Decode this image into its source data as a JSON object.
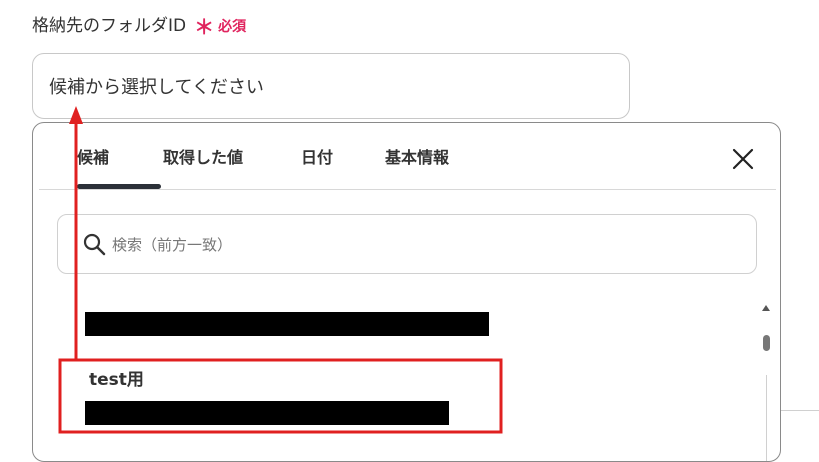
{
  "field": {
    "label": "格納先のフォルダID",
    "required_mark": "＊",
    "required_text": "必須",
    "placeholder": "候補から選択してください"
  },
  "dropdown": {
    "tabs": [
      {
        "label": "候補",
        "active": true
      },
      {
        "label": "取得した値",
        "active": false
      },
      {
        "label": "日付",
        "active": false
      },
      {
        "label": "基本情報",
        "active": false
      }
    ],
    "close_icon": "close-icon",
    "search": {
      "icon": "search-icon",
      "placeholder": "検索（前方一致）"
    },
    "items": [
      {
        "label": "",
        "value_redacted": true
      },
      {
        "label": "test用",
        "value_redacted": true
      }
    ]
  },
  "colors": {
    "required": "#e0245e",
    "annotation": "#e02020",
    "tab_indicator": "#2b3038",
    "redaction": "#000000"
  }
}
